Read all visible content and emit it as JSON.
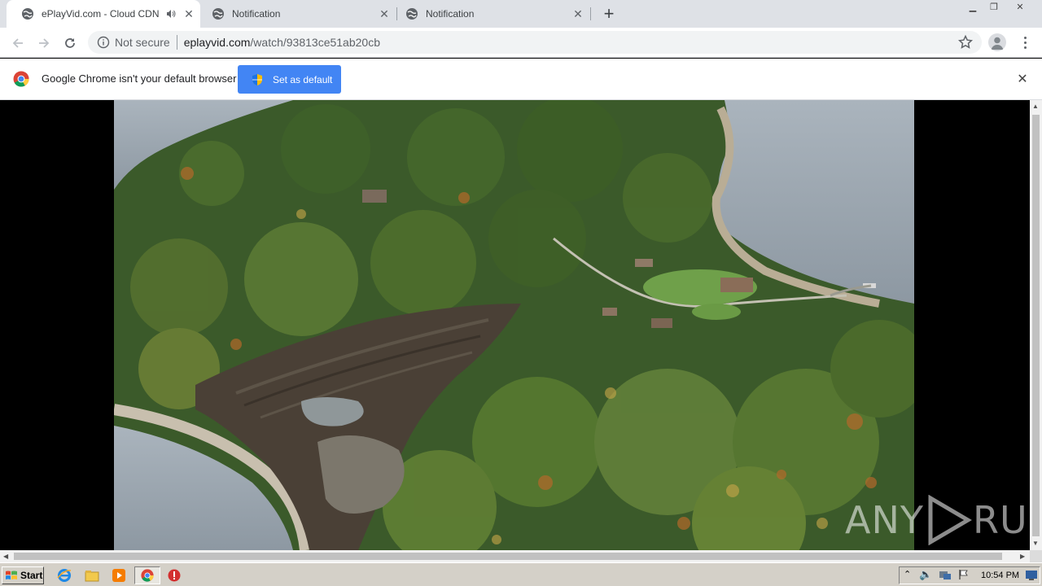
{
  "browser": {
    "tabs": [
      {
        "title": "ePlayVid.com - Cloud CDN",
        "active": true,
        "audio": true
      },
      {
        "title": "Notification",
        "active": false,
        "audio": false
      },
      {
        "title": "Notification",
        "active": false,
        "audio": false
      }
    ],
    "new_tab_icon": "plus-icon",
    "address": {
      "security_label": "Not secure",
      "host": "eplayvid.com",
      "path": "/watch/93813ce51ab20cb"
    }
  },
  "infobar": {
    "message": "Google Chrome isn't your default browser",
    "button_label": "Set as default",
    "accent": "#4285f4"
  },
  "video": {
    "watermark": "ANY RUN",
    "watermark_left": "ANY",
    "watermark_right": "RUN"
  },
  "taskbar": {
    "start_label": "Start",
    "clock": "10:54 PM",
    "pinned_icons": [
      "ie-icon",
      "explorer-icon",
      "media-player-icon",
      "chrome-icon",
      "stop-icon"
    ]
  },
  "colors": {
    "tabbar_bg": "#dee1e6",
    "taskbar_bg": "#d4d0c8",
    "omnibox_bg": "#f1f3f4"
  }
}
